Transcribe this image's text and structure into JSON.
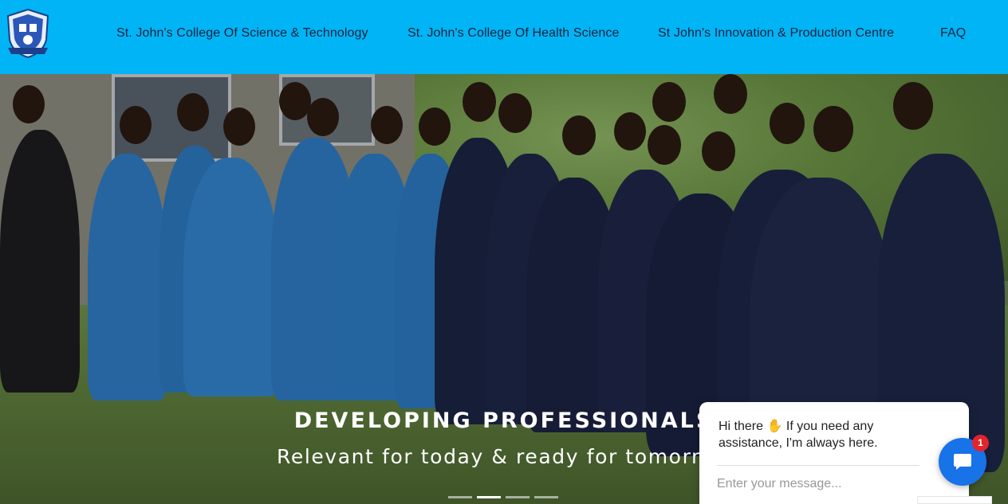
{
  "header": {
    "logo_icon": "college-crest-icon",
    "background": "#00b4f5",
    "nav": [
      {
        "label": "St. John's College Of Science & Technology"
      },
      {
        "label": "St. John's College Of Health Science"
      },
      {
        "label": "St John's Innovation & Production Centre"
      },
      {
        "label": "FAQ"
      }
    ]
  },
  "hero": {
    "title": "DEVELOPING PROFESSIONALS",
    "subtitle": "Relevant for today & ready for tomorr",
    "slides": 4,
    "active_slide": 2
  },
  "chat": {
    "greeting_pre": "Hi there ",
    "wave_icon": "waving-hand-icon",
    "greeting_post": " If you need any assistance, I'm always here.",
    "placeholder": "Enter your message...",
    "badge_count": "1",
    "button_icon": "chat-bubble-icon",
    "accent": "#1872e8",
    "badge_color": "#e3242b"
  }
}
